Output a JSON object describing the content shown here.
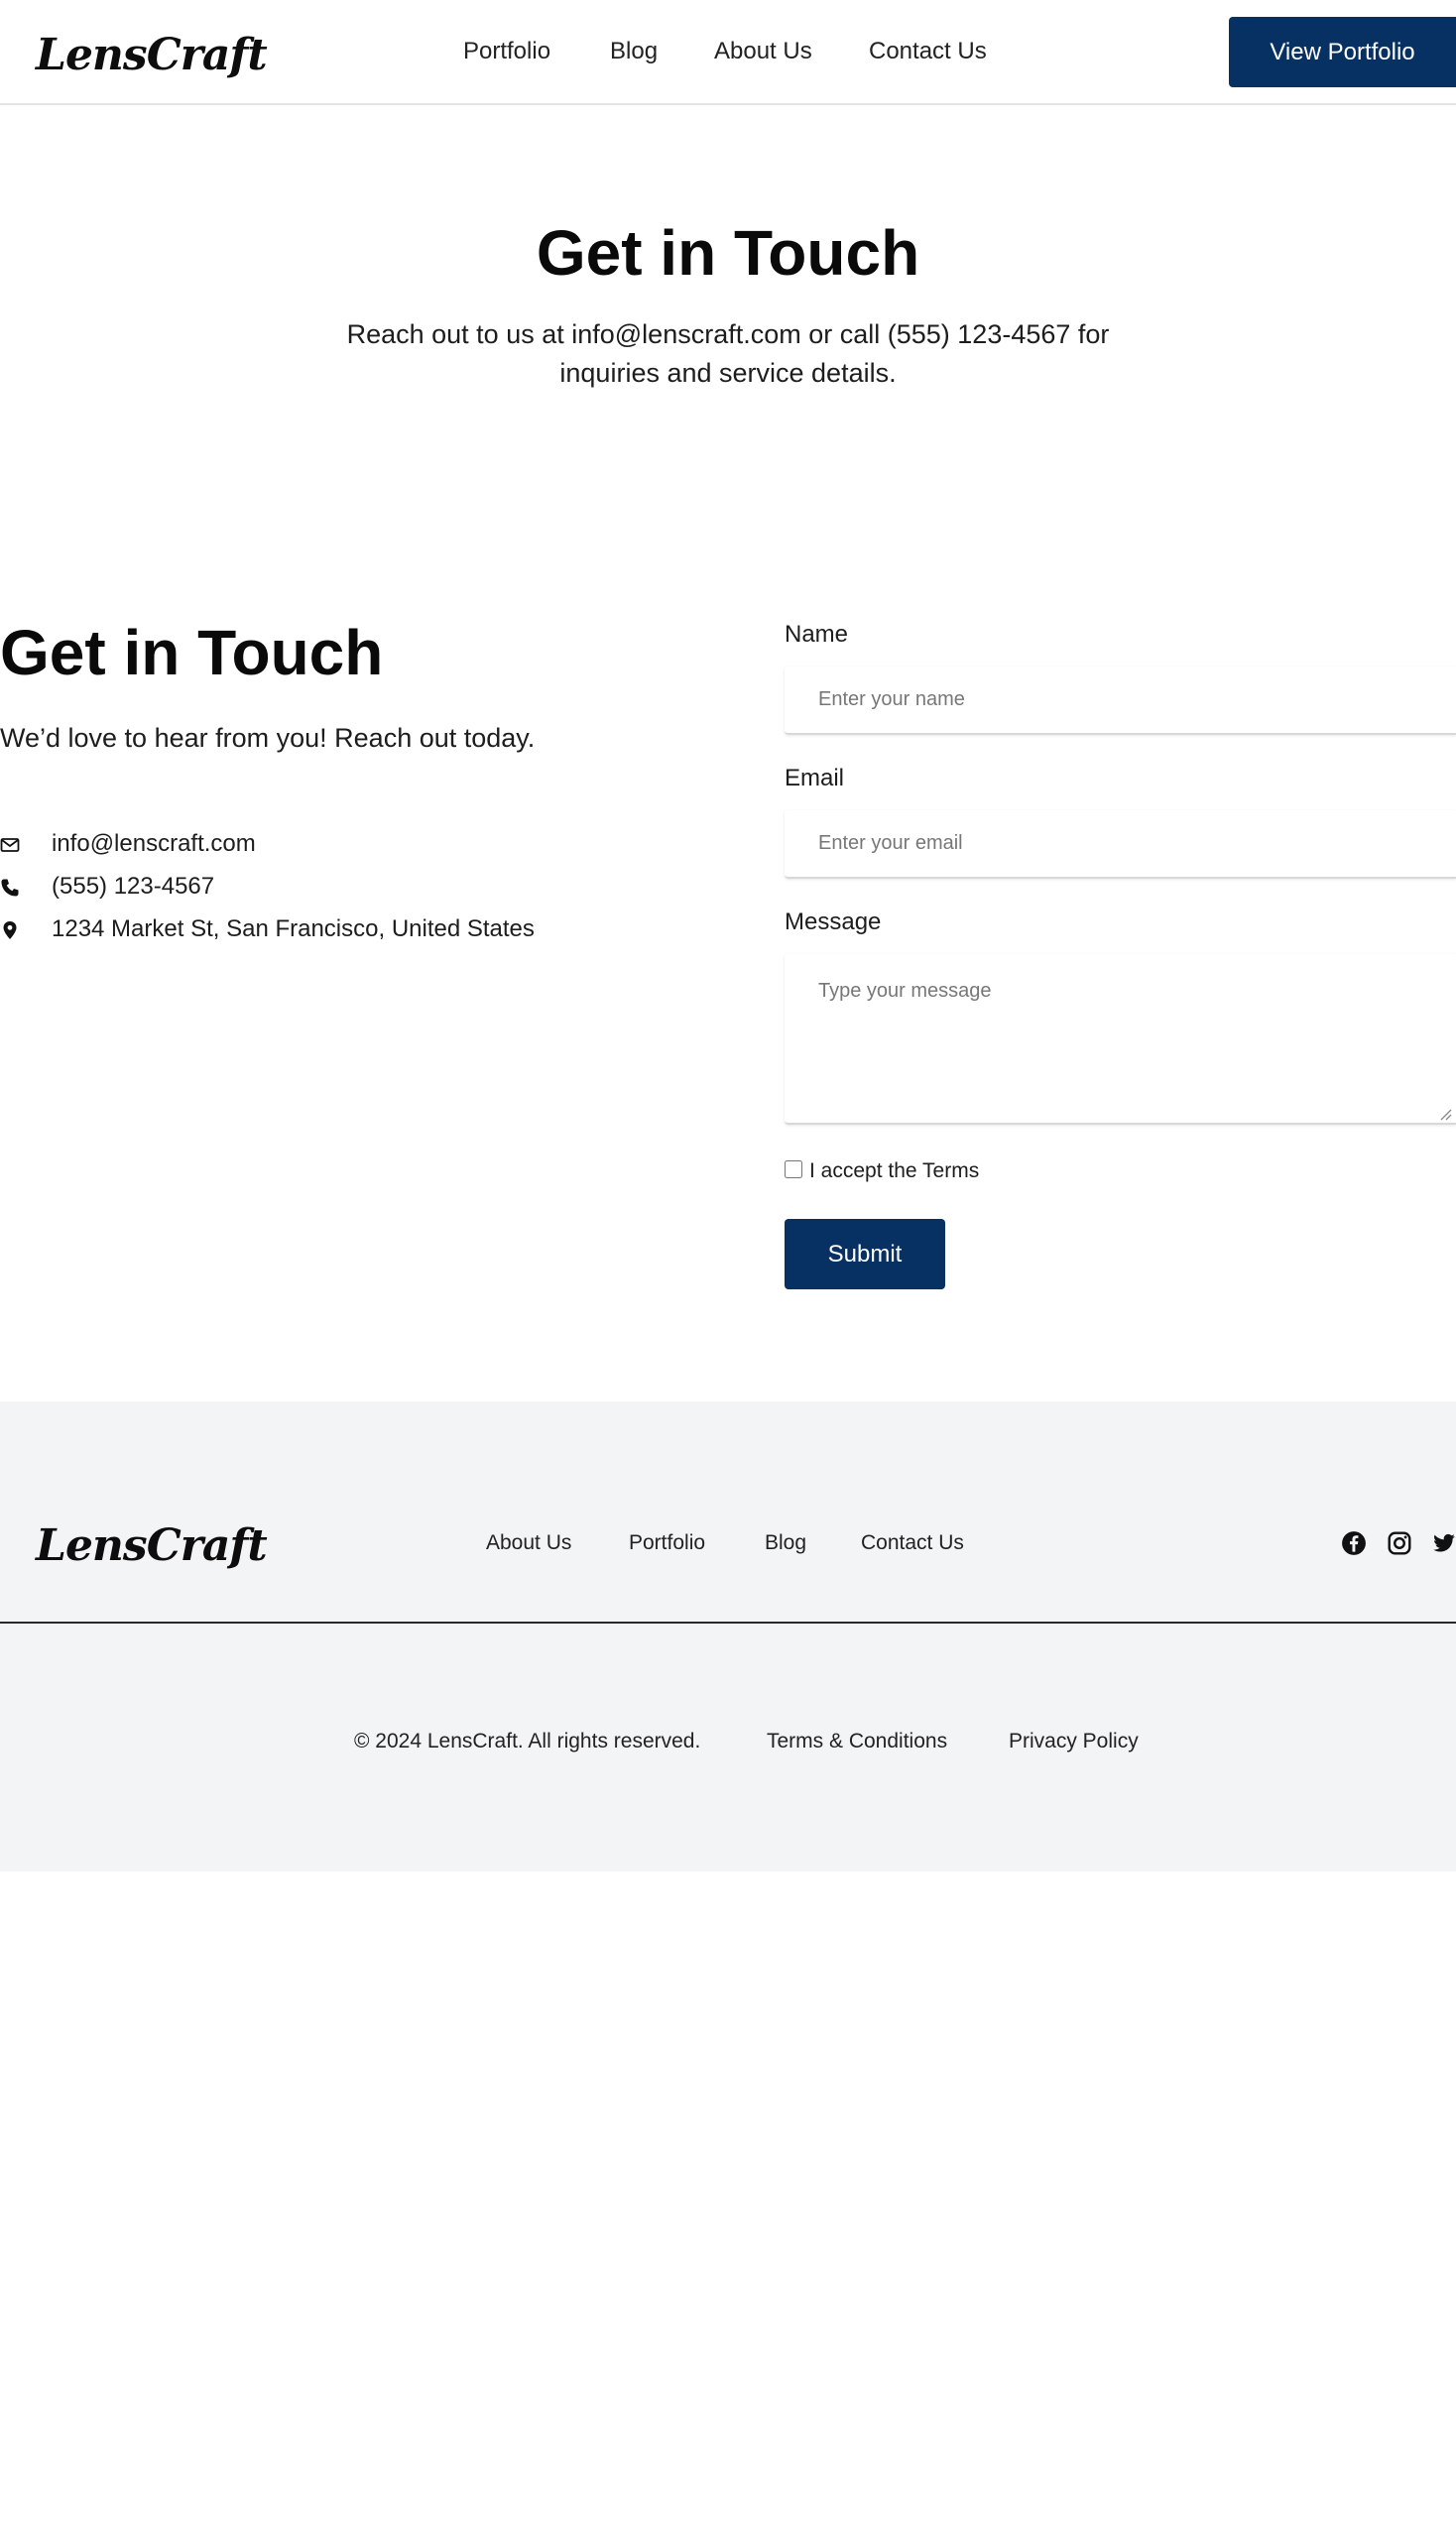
{
  "header": {
    "logo": "LensCraft",
    "nav": [
      "Portfolio",
      "Blog",
      "About Us",
      "Contact Us"
    ],
    "cta_label": "View Portfolio"
  },
  "hero": {
    "title": "Get in Touch",
    "subtitle": "Reach out to us at info@lenscraft.com or call (555) 123-4567 for inquiries and service details."
  },
  "contact": {
    "title": "Get in Touch",
    "subtitle": "We’d love to hear from you! Reach out today.",
    "email": "info@lenscraft.com",
    "phone": "(555) 123-4567",
    "address": "1234 Market St, San Francisco, United States",
    "icons": [
      "envelope-icon",
      "phone-icon",
      "map-pin-icon"
    ]
  },
  "form": {
    "name_label": "Name",
    "name_placeholder": "Enter your name",
    "name_value": "",
    "email_label": "Email",
    "email_placeholder": "Enter your email",
    "email_value": "",
    "message_label": "Message",
    "message_placeholder": "Type your message",
    "message_value": "",
    "terms_label": "I accept the Terms",
    "terms_checked": false,
    "submit_label": "Submit"
  },
  "footer": {
    "logo": "LensCraft",
    "nav": [
      "About Us",
      "Portfolio",
      "Blog",
      "Contact Us"
    ],
    "social": [
      "facebook-icon",
      "instagram-icon",
      "twitter-icon"
    ],
    "copyright": "© 2024 LensCraft. All rights reserved.",
    "terms": "Terms & Conditions",
    "privacy": "Privacy Policy"
  },
  "colors": {
    "primary": "#073163",
    "footer_bg": "#f3f4f6",
    "text": "#111111"
  }
}
